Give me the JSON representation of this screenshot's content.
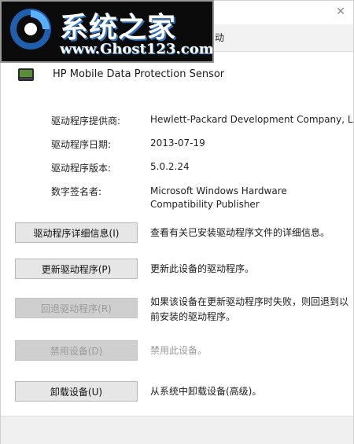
{
  "watermark": {
    "title": "系统之家",
    "url": "www.Ghost123.com"
  },
  "window": {
    "close_icon": "close-icon",
    "tab_label": "动"
  },
  "device": {
    "icon": "device-sensor-icon",
    "name": "HP Mobile Data Protection Sensor"
  },
  "info": [
    {
      "label": "驱动程序提供商:",
      "value": "Hewlett-Packard Development Company, L.P"
    },
    {
      "label": "驱动程序日期:",
      "value": "2013-07-19"
    },
    {
      "label": "驱动程序版本:",
      "value": "5.0.2.24"
    },
    {
      "label": "数字签名者:",
      "value": "Microsoft Windows Hardware\nCompatibility Publisher"
    }
  ],
  "actions": [
    {
      "button": "驱动程序详细信息(I)",
      "description": "查看有关已安装驱动程序文件的详细信息。",
      "enabled": true
    },
    {
      "button": "更新驱动程序(P)",
      "description": "更新此设备的驱动程序。",
      "enabled": true
    },
    {
      "button": "回退驱动程序(R)",
      "description": "如果该设备在更新驱动程序时失败，则回退到以前安装的驱动程序。",
      "enabled": false
    },
    {
      "button": "禁用设备(D)",
      "description": "禁用此设备。",
      "enabled": false
    },
    {
      "button": "卸载设备(U)",
      "description": "从系统中卸载设备(高级)。",
      "enabled": true
    }
  ]
}
